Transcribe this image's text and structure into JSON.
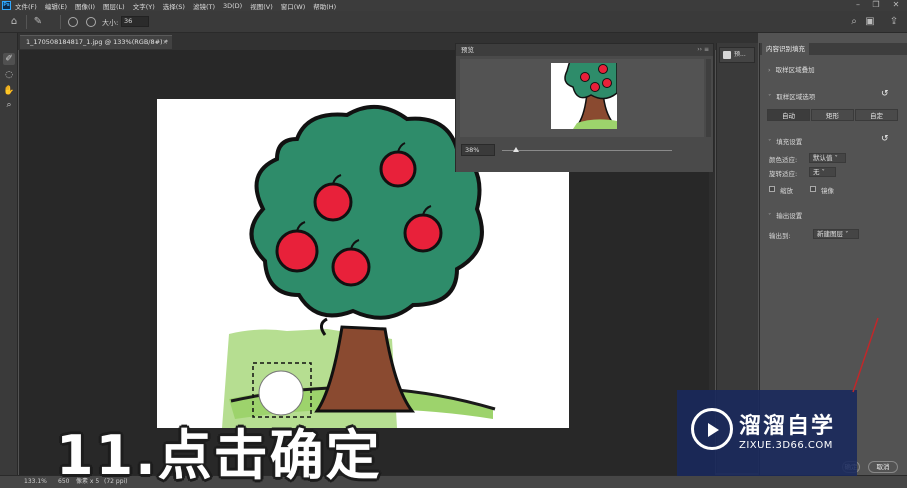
{
  "menubar": {
    "logo": "Ps",
    "items": [
      "文件(F)",
      "编辑(E)",
      "图像(I)",
      "图层(L)",
      "文字(Y)",
      "选择(S)",
      "滤镜(T)",
      "3D(D)",
      "视图(V)",
      "窗口(W)",
      "帮助(H)"
    ]
  },
  "options": {
    "size_label": "大小:",
    "size_value": "36"
  },
  "document": {
    "tab_title": "1_170508184817_1.jpg @ 133%(RGB/8#) *",
    "close": "×"
  },
  "preview": {
    "title": "预览",
    "zoom": "38%",
    "zoom_fraction": 0.08
  },
  "mini_panel": {
    "button_label": "预..."
  },
  "props": {
    "tab": "内容识别填充",
    "sampling_overlay": "取样区域叠加",
    "sampling_options": "取样区域选项",
    "modes": [
      "自动",
      "矩形",
      "自定"
    ],
    "fill_settings": "填充设置",
    "color_adapt_label": "颜色适应:",
    "color_adapt_value": "默认值",
    "rotate_adapt_label": "旋转适应:",
    "rotate_adapt_value": "无",
    "scale_label": "缩放",
    "mirror_label": "镜像",
    "output_settings": "输出设置",
    "output_to_label": "输出到:",
    "output_to_value": "新建图层",
    "ok": "确定",
    "cancel": "取消"
  },
  "status": {
    "zoom": "133.1%",
    "width": "650",
    "units": "像素 x 5",
    "extra": "(72 ppi)"
  },
  "caption": "11.点击确定",
  "watermark": {
    "title": "溜溜自学",
    "url": "ZIXUE.3D66.COM"
  },
  "colors": {
    "apple": "#e8213a",
    "foliage": "#2e8c6a",
    "trunk": "#8a4a30",
    "grass": "#9dd36c",
    "accent": "#c0282a"
  },
  "icons": [
    "home-icon",
    "brush-icon",
    "play-icon",
    "circle-icon",
    "search-icon",
    "layout-icon",
    "share-icon",
    "sampling-brush-icon",
    "lasso-icon",
    "hand-icon",
    "zoom-icon",
    "reset-icon"
  ]
}
